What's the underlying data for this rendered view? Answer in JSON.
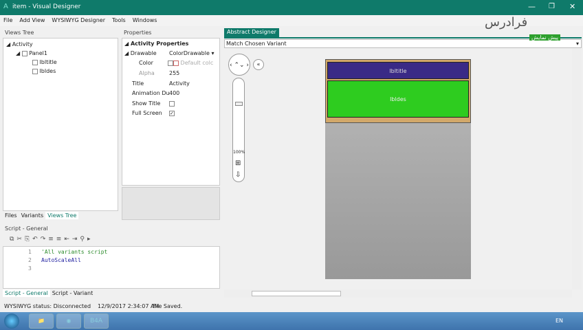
{
  "window": {
    "title": "item - Visual Designer",
    "icon": "b4a-icon"
  },
  "menu": [
    "File",
    "Add View",
    "WYSIWYG Designer",
    "Tools",
    "Windows"
  ],
  "views_tree": {
    "title": "Views Tree",
    "items": [
      "Activity",
      "Panel1",
      "lbltitle",
      "lbldes"
    ],
    "tabs": [
      "Files",
      "Variants",
      "Views Tree"
    ]
  },
  "properties": {
    "title": "Properties",
    "section": "Activity Properties",
    "rows": [
      {
        "name": "Drawable",
        "value": "ColorDrawable"
      },
      {
        "name": "Color",
        "value": "Default colc"
      },
      {
        "name": "Alpha",
        "value": "255"
      },
      {
        "name": "Title",
        "value": "Activity"
      },
      {
        "name": "Animation Du",
        "value": "400"
      },
      {
        "name": "Show Title",
        "value": ""
      },
      {
        "name": "Full Screen",
        "value": "checked"
      }
    ]
  },
  "script": {
    "title": "Script - General",
    "lines": [
      "'All variants script",
      "AutoScaleAll",
      ""
    ],
    "line_numbers": [
      "1",
      "2",
      "3"
    ],
    "tabs": [
      "Script - General",
      "Script - Variant"
    ]
  },
  "designer": {
    "tab": "Abstract Designer",
    "variant": "Match Chosen Variant",
    "zoom": "100%",
    "title_label": "lbltitle",
    "des_label": "lbldes",
    "colors": {
      "title": "#3a2a86",
      "des": "#2ecc1f",
      "panel": "#d2a86a"
    }
  },
  "status": {
    "wysiwyg": "WYSIWYG status: Disconnected",
    "time": "12/9/2017 2:34:07 AM",
    "msg": "File Saved."
  },
  "watermark": {
    "logo": "فرادرس",
    "badge": "پیش نمایش"
  },
  "taskbar": {
    "b4a": "B4A",
    "lang": "EN"
  }
}
